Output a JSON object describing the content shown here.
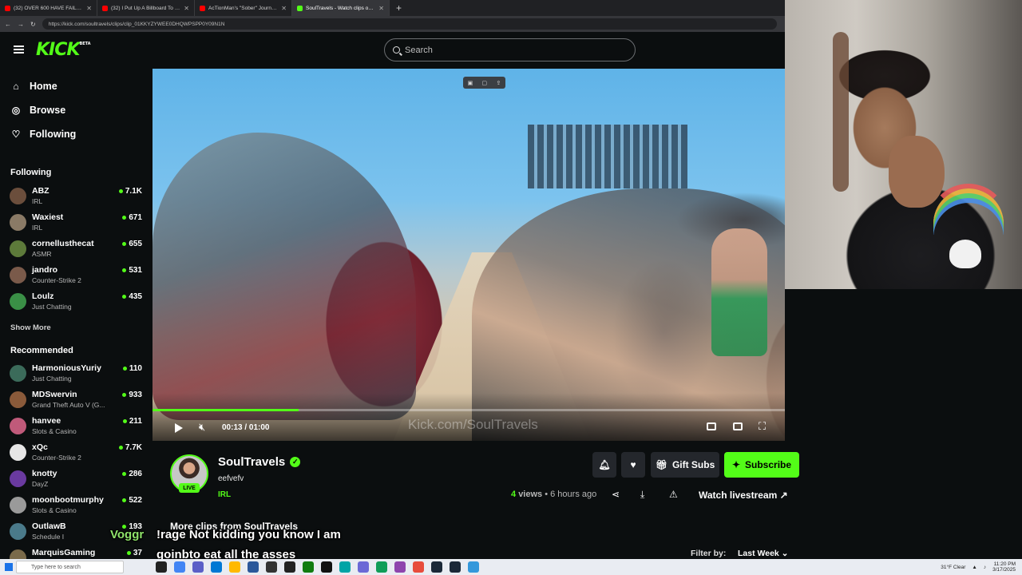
{
  "browser": {
    "tabs": [
      {
        "title": "(32) OVER 600 HAVE FAILED FOR",
        "favicon_color": "#ff0000",
        "active": false
      },
      {
        "title": "(32) I Put Up A Billboard To Find L",
        "favicon_color": "#ff0000",
        "active": false
      },
      {
        "title": "AcTionMan's \"Sober\" Journey Ju",
        "favicon_color": "#ff0000",
        "active": false
      },
      {
        "title": "SoulTravels - Watch clips on Kick",
        "favicon_color": "#53fc18",
        "active": true
      }
    ],
    "url": "https://kick.com/soultravels/clips/clip_01KKYZYWEE0DHQWPSPP0Y09N1N"
  },
  "header": {
    "logo": "KICK",
    "logo_badge": "BETA",
    "search_placeholder": "Search"
  },
  "sidebar": {
    "nav": [
      {
        "label": "Home",
        "icon": "home-icon"
      },
      {
        "label": "Browse",
        "icon": "compass-icon"
      },
      {
        "label": "Following",
        "icon": "heart-icon"
      }
    ],
    "following_title": "Following",
    "following": [
      {
        "name": "ABZ",
        "category": "IRL",
        "viewers": "7.1K",
        "avatar_color": "#6b4e3c"
      },
      {
        "name": "Waxiest",
        "category": "IRL",
        "viewers": "671",
        "avatar_color": "#8a7a66"
      },
      {
        "name": "cornellusthecat",
        "category": "ASMR",
        "viewers": "655",
        "avatar_color": "#5d7a3a"
      },
      {
        "name": "jandro",
        "category": "Counter-Strike 2",
        "viewers": "531",
        "avatar_color": "#7a5a4a"
      },
      {
        "name": "Loulz",
        "category": "Just Chatting",
        "viewers": "435",
        "avatar_color": "#3a8f46"
      }
    ],
    "show_more": "Show More",
    "recommended_title": "Recommended",
    "recommended": [
      {
        "name": "HarmoniousYuriy",
        "category": "Just Chatting",
        "viewers": "110",
        "avatar_color": "#3b6b5a"
      },
      {
        "name": "MDSwervin",
        "category": "Grand Theft Auto V (G...",
        "viewers": "933",
        "avatar_color": "#8a5a3a"
      },
      {
        "name": "hanvee",
        "category": "Slots & Casino",
        "viewers": "211",
        "avatar_color": "#c05a7a"
      },
      {
        "name": "xQc",
        "category": "Counter-Strike 2",
        "viewers": "7.7K",
        "avatar_color": "#e6e6e6"
      },
      {
        "name": "knotty",
        "category": "DayZ",
        "viewers": "286",
        "avatar_color": "#6a3aa0"
      },
      {
        "name": "moonbootmurphy",
        "category": "Slots & Casino",
        "viewers": "522",
        "avatar_color": "#9a9a9a"
      },
      {
        "name": "OutlawB",
        "category": "Schedule I",
        "viewers": "193",
        "avatar_color": "#4a7a8a"
      },
      {
        "name": "MarquisGaming",
        "category": "",
        "viewers": "37",
        "avatar_color": "#7a6a4a"
      }
    ]
  },
  "player": {
    "current_time": "00:13",
    "duration": "01:00",
    "progress_fraction": 0.22,
    "watermark": "Kick.com/SoulTravels"
  },
  "clip": {
    "channel_name": "SoulTravels",
    "live_label": "LIVE",
    "title": "eefvefv",
    "category": "IRL",
    "views_count": "4",
    "views_label": "views",
    "age": "• 6 hours ago",
    "gift_subs": "Gift Subs",
    "subscribe": "Subscribe",
    "watch_livestream": "Watch livestream"
  },
  "more_clips": {
    "title": "More clips from SoulTravels",
    "filter_label": "Filter by:",
    "filter_value": "Last Week"
  },
  "captions": {
    "username": "Voggr",
    "line1": "!rage Not kidding you know I am",
    "line2": "goinbto eat all the asses"
  },
  "taskbar": {
    "search_placeholder": "Type here to search",
    "weather": "31°F  Clear",
    "time": "11:20 PM",
    "date": "3/17/2025"
  },
  "colors": {
    "accent": "#53fc18",
    "background": "#0b0e0f"
  }
}
